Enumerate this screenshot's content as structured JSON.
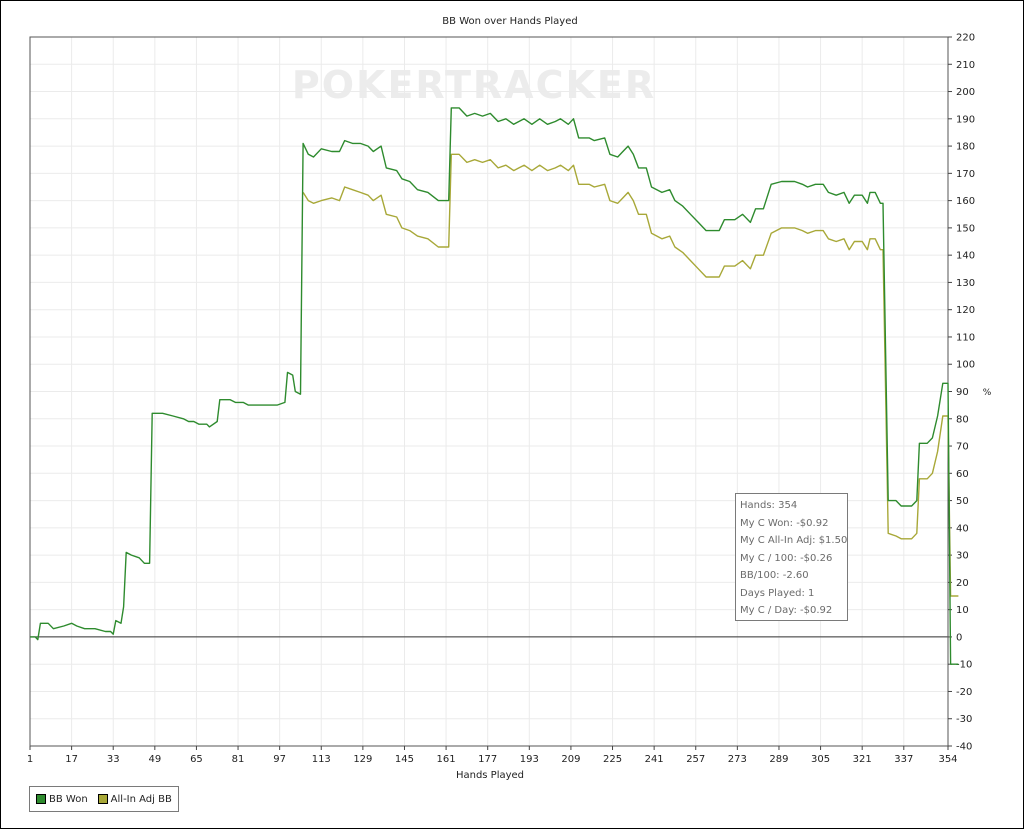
{
  "chart_data": {
    "type": "line",
    "title": "BB Won over Hands Played",
    "xlabel": "Hands Played",
    "ylabel": "%",
    "xlim": [
      1,
      354
    ],
    "ylim": [
      -40,
      220
    ],
    "grid": true,
    "y_axis_position": "right",
    "x_ticks": [
      1,
      17,
      33,
      49,
      65,
      81,
      97,
      113,
      129,
      145,
      161,
      177,
      193,
      209,
      225,
      241,
      257,
      273,
      289,
      305,
      321,
      337,
      354
    ],
    "y_ticks": [
      -40,
      -30,
      -20,
      -10,
      0,
      10,
      20,
      30,
      40,
      50,
      60,
      70,
      80,
      90,
      100,
      110,
      120,
      130,
      140,
      150,
      160,
      170,
      180,
      190,
      200,
      210,
      220
    ],
    "watermark": "POKERTRACKER",
    "legend_position": "bottom-left",
    "series": [
      {
        "name": "BB Won",
        "color": "#2e8b2e",
        "points": [
          [
            1,
            0
          ],
          [
            3,
            0
          ],
          [
            4,
            -1
          ],
          [
            5,
            5
          ],
          [
            8,
            5
          ],
          [
            10,
            3
          ],
          [
            14,
            4
          ],
          [
            17,
            5
          ],
          [
            19,
            4
          ],
          [
            22,
            3
          ],
          [
            26,
            3
          ],
          [
            30,
            2
          ],
          [
            32,
            2
          ],
          [
            33,
            1
          ],
          [
            34,
            6
          ],
          [
            36,
            5
          ],
          [
            37,
            11
          ],
          [
            38,
            31
          ],
          [
            40,
            30
          ],
          [
            43,
            29
          ],
          [
            45,
            27
          ],
          [
            47,
            27
          ],
          [
            48,
            82
          ],
          [
            52,
            82
          ],
          [
            56,
            81
          ],
          [
            60,
            80
          ],
          [
            62,
            79
          ],
          [
            64,
            79
          ],
          [
            66,
            78
          ],
          [
            69,
            78
          ],
          [
            70,
            77
          ],
          [
            73,
            79
          ],
          [
            74,
            87
          ],
          [
            78,
            87
          ],
          [
            80,
            86
          ],
          [
            83,
            86
          ],
          [
            85,
            85
          ],
          [
            90,
            85
          ],
          [
            96,
            85
          ],
          [
            99,
            86
          ],
          [
            100,
            97
          ],
          [
            102,
            96
          ],
          [
            103,
            90
          ],
          [
            105,
            89
          ],
          [
            106,
            181
          ],
          [
            108,
            177
          ],
          [
            110,
            176
          ],
          [
            113,
            179
          ],
          [
            117,
            178
          ],
          [
            120,
            178
          ],
          [
            122,
            182
          ],
          [
            125,
            181
          ],
          [
            128,
            181
          ],
          [
            131,
            180
          ],
          [
            133,
            178
          ],
          [
            136,
            180
          ],
          [
            138,
            172
          ],
          [
            142,
            171
          ],
          [
            144,
            168
          ],
          [
            147,
            167
          ],
          [
            150,
            164
          ],
          [
            154,
            163
          ],
          [
            158,
            160
          ],
          [
            162,
            160
          ],
          [
            163,
            194
          ],
          [
            166,
            194
          ],
          [
            169,
            191
          ],
          [
            172,
            192
          ],
          [
            175,
            191
          ],
          [
            178,
            192
          ],
          [
            181,
            189
          ],
          [
            184,
            190
          ],
          [
            187,
            188
          ],
          [
            189,
            189
          ],
          [
            191,
            190
          ],
          [
            194,
            188
          ],
          [
            197,
            190
          ],
          [
            200,
            188
          ],
          [
            203,
            189
          ],
          [
            205,
            190
          ],
          [
            208,
            188
          ],
          [
            210,
            190
          ],
          [
            212,
            183
          ],
          [
            216,
            183
          ],
          [
            218,
            182
          ],
          [
            222,
            183
          ],
          [
            224,
            177
          ],
          [
            227,
            176
          ],
          [
            229,
            178
          ],
          [
            231,
            180
          ],
          [
            233,
            177
          ],
          [
            235,
            172
          ],
          [
            238,
            172
          ],
          [
            240,
            165
          ],
          [
            244,
            163
          ],
          [
            247,
            164
          ],
          [
            249,
            160
          ],
          [
            252,
            158
          ],
          [
            255,
            155
          ],
          [
            258,
            152
          ],
          [
            261,
            149
          ],
          [
            266,
            149
          ],
          [
            268,
            153
          ],
          [
            272,
            153
          ],
          [
            275,
            155
          ],
          [
            278,
            152
          ],
          [
            280,
            157
          ],
          [
            283,
            157
          ],
          [
            286,
            166
          ],
          [
            290,
            167
          ],
          [
            295,
            167
          ],
          [
            298,
            166
          ],
          [
            300,
            165
          ],
          [
            303,
            166
          ],
          [
            306,
            166
          ],
          [
            308,
            163
          ],
          [
            311,
            162
          ],
          [
            314,
            163
          ],
          [
            316,
            159
          ],
          [
            318,
            162
          ],
          [
            321,
            162
          ],
          [
            323,
            159
          ],
          [
            324,
            163
          ],
          [
            326,
            163
          ],
          [
            328,
            159
          ],
          [
            329,
            159
          ],
          [
            331,
            50
          ],
          [
            334,
            50
          ],
          [
            336,
            48
          ],
          [
            340,
            48
          ],
          [
            342,
            50
          ],
          [
            343,
            71
          ],
          [
            346,
            71
          ],
          [
            348,
            73
          ],
          [
            350,
            81
          ],
          [
            352,
            93
          ],
          [
            354,
            93
          ],
          [
            355,
            -10
          ],
          [
            358,
            -10
          ]
        ]
      },
      {
        "name": "All-In Adj BB",
        "color": "#a8a838",
        "points": [
          [
            106,
            163
          ],
          [
            108,
            160
          ],
          [
            110,
            159
          ],
          [
            113,
            160
          ],
          [
            117,
            161
          ],
          [
            120,
            160
          ],
          [
            122,
            165
          ],
          [
            125,
            164
          ],
          [
            128,
            163
          ],
          [
            131,
            162
          ],
          [
            133,
            160
          ],
          [
            136,
            162
          ],
          [
            138,
            155
          ],
          [
            142,
            154
          ],
          [
            144,
            150
          ],
          [
            147,
            149
          ],
          [
            150,
            147
          ],
          [
            154,
            146
          ],
          [
            158,
            143
          ],
          [
            162,
            143
          ],
          [
            163,
            177
          ],
          [
            166,
            177
          ],
          [
            169,
            174
          ],
          [
            172,
            175
          ],
          [
            175,
            174
          ],
          [
            178,
            175
          ],
          [
            181,
            172
          ],
          [
            184,
            173
          ],
          [
            187,
            171
          ],
          [
            189,
            172
          ],
          [
            191,
            173
          ],
          [
            194,
            171
          ],
          [
            197,
            173
          ],
          [
            200,
            171
          ],
          [
            203,
            172
          ],
          [
            205,
            173
          ],
          [
            208,
            171
          ],
          [
            210,
            173
          ],
          [
            212,
            166
          ],
          [
            216,
            166
          ],
          [
            218,
            165
          ],
          [
            222,
            166
          ],
          [
            224,
            160
          ],
          [
            227,
            159
          ],
          [
            229,
            161
          ],
          [
            231,
            163
          ],
          [
            233,
            160
          ],
          [
            235,
            155
          ],
          [
            238,
            155
          ],
          [
            240,
            148
          ],
          [
            244,
            146
          ],
          [
            247,
            147
          ],
          [
            249,
            143
          ],
          [
            252,
            141
          ],
          [
            255,
            138
          ],
          [
            258,
            135
          ],
          [
            261,
            132
          ],
          [
            266,
            132
          ],
          [
            268,
            136
          ],
          [
            272,
            136
          ],
          [
            275,
            138
          ],
          [
            278,
            135
          ],
          [
            280,
            140
          ],
          [
            283,
            140
          ],
          [
            286,
            148
          ],
          [
            290,
            150
          ],
          [
            295,
            150
          ],
          [
            298,
            149
          ],
          [
            300,
            148
          ],
          [
            303,
            149
          ],
          [
            306,
            149
          ],
          [
            308,
            146
          ],
          [
            311,
            145
          ],
          [
            314,
            146
          ],
          [
            316,
            142
          ],
          [
            318,
            145
          ],
          [
            321,
            145
          ],
          [
            323,
            142
          ],
          [
            324,
            146
          ],
          [
            326,
            146
          ],
          [
            328,
            142
          ],
          [
            329,
            142
          ],
          [
            331,
            38
          ],
          [
            334,
            37
          ],
          [
            336,
            36
          ],
          [
            340,
            36
          ],
          [
            342,
            38
          ],
          [
            343,
            58
          ],
          [
            346,
            58
          ],
          [
            348,
            60
          ],
          [
            350,
            68
          ],
          [
            352,
            81
          ],
          [
            354,
            81
          ],
          [
            355,
            15
          ],
          [
            358,
            15
          ]
        ]
      }
    ]
  },
  "stats": [
    "Hands: 354",
    "My C Won: -$0.92",
    "My C All-In Adj: $1.50",
    "My C / 100: -$0.26",
    "BB/100: -2.60",
    "Days Played: 1",
    "My C / Day: -$0.92"
  ],
  "legend": [
    {
      "label": "BB Won",
      "color": "#2e8b2e"
    },
    {
      "label": "All-In Adj BB",
      "color": "#a8a838"
    }
  ]
}
